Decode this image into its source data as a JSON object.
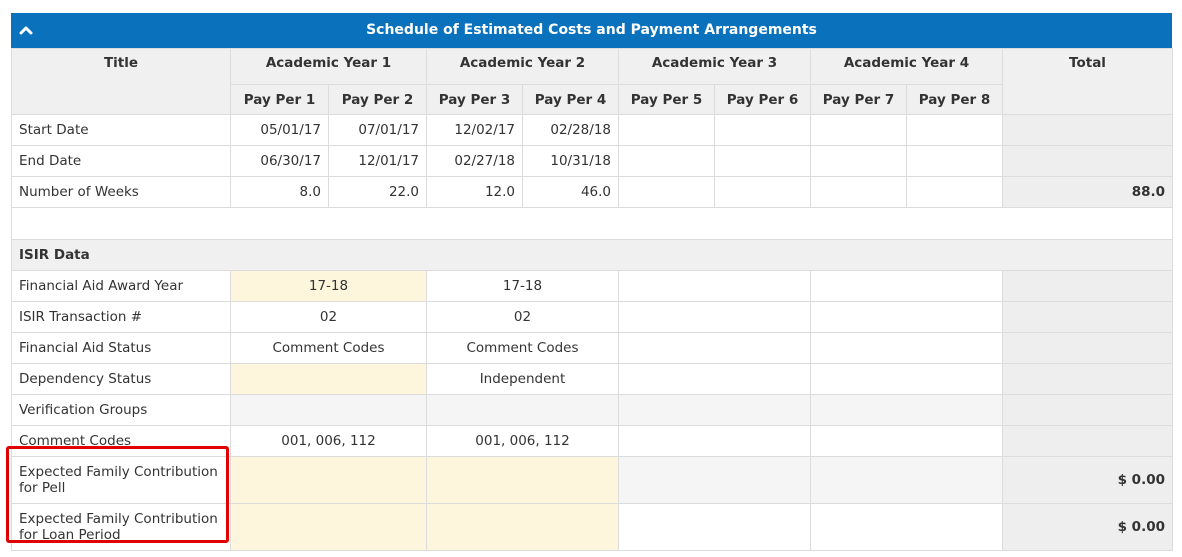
{
  "header": {
    "title": "Schedule of Estimated Costs and Payment Arrangements",
    "collapse_icon": "chevron-up-icon"
  },
  "columns": {
    "title": "Title",
    "years": [
      "Academic Year 1",
      "Academic Year 2",
      "Academic Year 3",
      "Academic Year 4"
    ],
    "periods": [
      "Pay Per 1",
      "Pay Per 2",
      "Pay Per 3",
      "Pay Per 4",
      "Pay Per 5",
      "Pay Per 6",
      "Pay Per 7",
      "Pay Per 8"
    ],
    "total": "Total"
  },
  "schedule_rows": [
    {
      "label": "Start Date",
      "values": [
        "05/01/17",
        "07/01/17",
        "12/02/17",
        "02/28/18",
        "",
        "",
        "",
        ""
      ],
      "total": ""
    },
    {
      "label": "End Date",
      "values": [
        "06/30/17",
        "12/01/17",
        "02/27/18",
        "10/31/18",
        "",
        "",
        "",
        ""
      ],
      "total": ""
    },
    {
      "label": "Number of Weeks",
      "values": [
        "8.0",
        "22.0",
        "12.0",
        "46.0",
        "",
        "",
        "",
        ""
      ],
      "total": "88.0"
    }
  ],
  "isir": {
    "section_label": "ISIR Data",
    "rows": [
      {
        "label": "Financial Aid Award Year",
        "years": [
          "17-18",
          "17-18",
          "",
          ""
        ],
        "total": ""
      },
      {
        "label": "ISIR Transaction #",
        "years": [
          "02",
          "02",
          "",
          ""
        ],
        "total": ""
      },
      {
        "label": "Financial Aid Status",
        "years": [
          "Comment Codes",
          "Comment Codes",
          "",
          ""
        ],
        "total": ""
      },
      {
        "label": "Dependency Status",
        "years": [
          "",
          "Independent",
          "",
          ""
        ],
        "total": ""
      },
      {
        "label": "Verification Groups",
        "years": [
          "",
          "",
          "",
          ""
        ],
        "total": ""
      },
      {
        "label": "Comment Codes",
        "years": [
          "001, 006, 112",
          "001, 006, 112",
          "",
          ""
        ],
        "total": ""
      },
      {
        "label": "Expected Family Contribution for Pell",
        "years": [
          "",
          "",
          "",
          ""
        ],
        "total": "$ 0.00"
      },
      {
        "label": "Expected Family Contribution for Loan Period",
        "years": [
          "",
          "",
          "",
          ""
        ],
        "total": "$ 0.00"
      }
    ]
  },
  "colors": {
    "header_blue": "#0a72bd",
    "editable_yellow": "#fdf6dd",
    "highlight_red": "#e00000"
  }
}
